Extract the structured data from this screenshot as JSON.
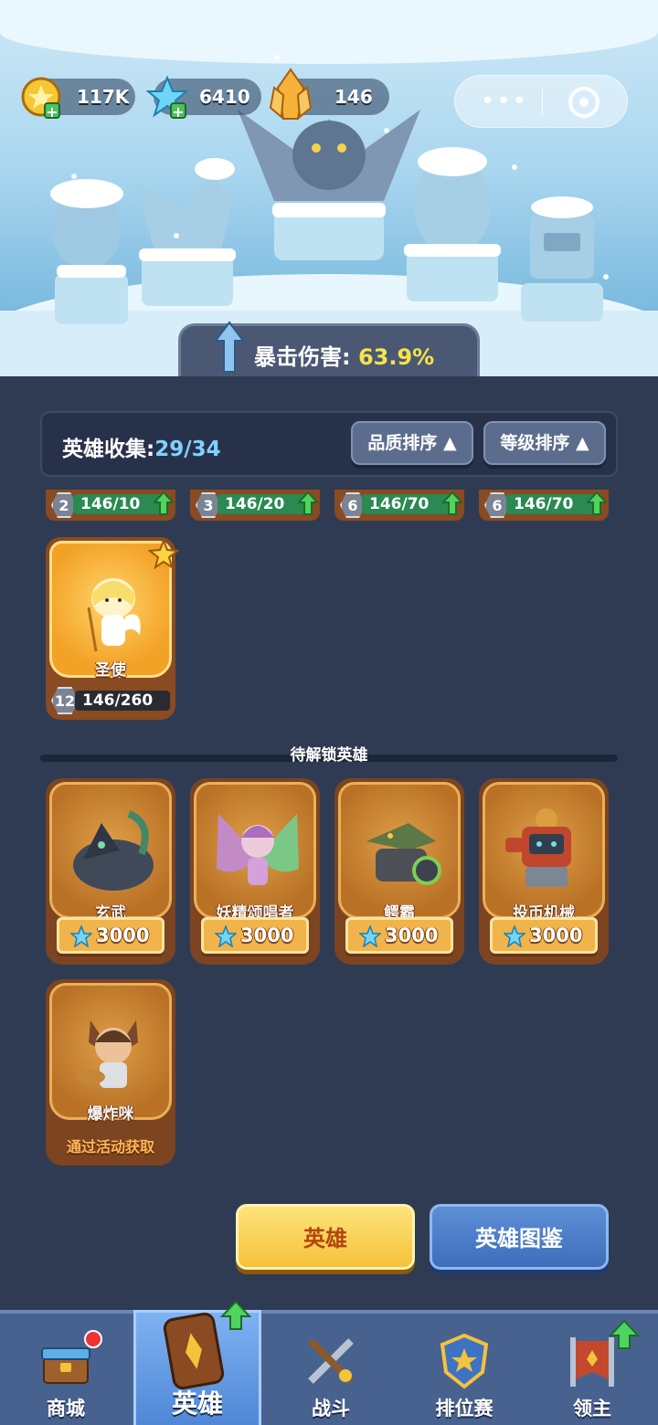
{
  "currencies": [
    {
      "icon": "gold-coin-icon",
      "value": "117K"
    },
    {
      "icon": "blue-crystal-icon",
      "value": "6410"
    },
    {
      "icon": "orange-crystal-icon",
      "value": "146"
    }
  ],
  "crit": {
    "label": "暴击伤害:",
    "value": "63.9%"
  },
  "collection": {
    "label": "英雄收集:",
    "count": "29/34"
  },
  "sort": {
    "quality": "品质排序",
    "level": "等级排序"
  },
  "owned_strips": [
    {
      "level": "2",
      "progress": "146/10"
    },
    {
      "level": "3",
      "progress": "146/20"
    },
    {
      "level": "6",
      "progress": "146/70"
    },
    {
      "level": "6",
      "progress": "146/70"
    }
  ],
  "owned_hero": {
    "name": "圣使",
    "level": "12",
    "progress": "146/260"
  },
  "locked_section": {
    "title": "待解锁英雄"
  },
  "locked_heroes": [
    {
      "name": "玄武",
      "price": "3000"
    },
    {
      "name": "妖精颂唱者",
      "price": "3000"
    },
    {
      "name": "鳄霸",
      "price": "3000"
    },
    {
      "name": "投币机械",
      "price": "3000"
    },
    {
      "name": "爆炸咪",
      "event_note": "通过活动获取"
    }
  ],
  "buttons": {
    "hero": "英雄",
    "guide": "英雄图鉴"
  },
  "nav": [
    {
      "label": "商城",
      "icon": "shop-chest-icon"
    },
    {
      "label": "英雄",
      "icon": "hero-card-icon"
    },
    {
      "label": "战斗",
      "icon": "crossed-weapons-icon"
    },
    {
      "label": "排位赛",
      "icon": "rank-shield-icon"
    },
    {
      "label": "领主",
      "icon": "banner-flag-icon"
    }
  ],
  "colors": {
    "accent_gold": "#f5c23c",
    "accent_blue": "#4f87d6",
    "crit_value": "#f7e24a",
    "count_value": "#7fd2ff"
  }
}
